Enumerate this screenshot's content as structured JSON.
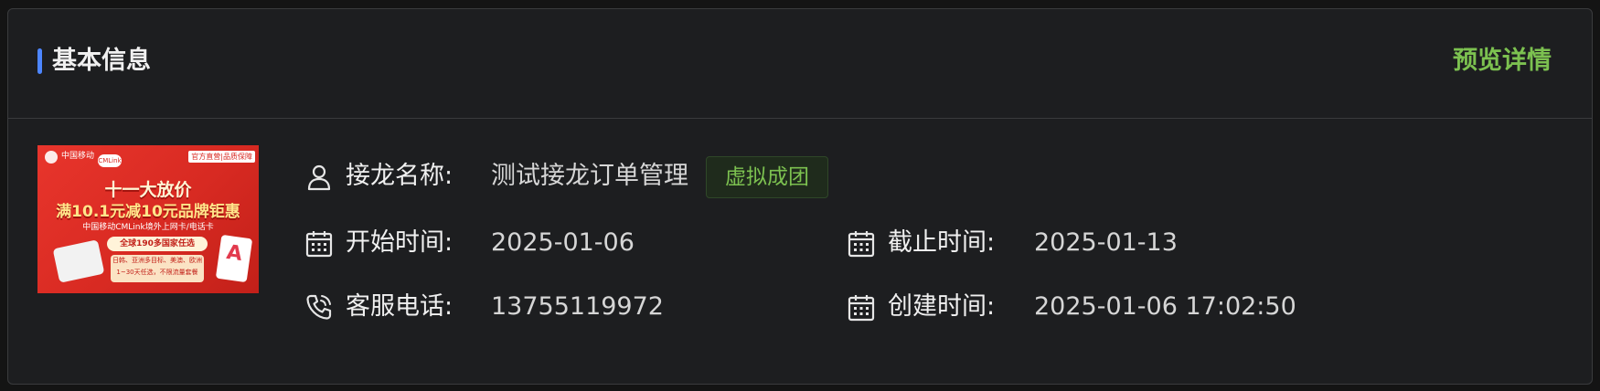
{
  "card": {
    "title": "基本信息",
    "preview_link": "预览详情"
  },
  "product_image": {
    "top_left": "中国移动",
    "brand": "CMLink",
    "official_badge": "官方直营|品质保障",
    "headline1": "十一大放价",
    "headline2": "满10.1元减10元品牌钜惠",
    "subline": "中国移动CMLink境外上网卡/电话卡",
    "pill": "全球190多国家任选",
    "pill_detail": "日韩、亚洲多目标、美澳、欧洲 1~30天任选，不限流量套餐"
  },
  "info": {
    "name_label": "接龙名称:",
    "name_value": "测试接龙订单管理",
    "status_tag": "虚拟成团",
    "start_label": "开始时间:",
    "start_value": "2025-01-06",
    "end_label": "截止时间:",
    "end_value": "2025-01-13",
    "phone_label": "客服电话:",
    "phone_value": "13755119972",
    "created_label": "创建时间:",
    "created_value": "2025-01-06 17:02:50"
  },
  "colors": {
    "accent_blue": "#4d86ff",
    "accent_green": "#7cc150",
    "background": "#1d1e20"
  },
  "icons": [
    "user-icon",
    "calendar-icon",
    "phone-icon"
  ]
}
